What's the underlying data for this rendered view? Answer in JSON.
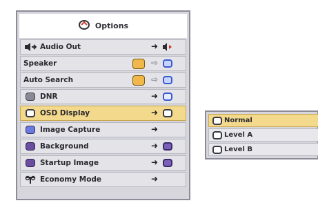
{
  "menu": {
    "title": "Options",
    "items": [
      {
        "label": "Audio Out",
        "lead_icon": "speaker-audio-out-icon",
        "setting_icon": "speaker-red-arrow-icon"
      },
      {
        "label": "Speaker",
        "toggle": true,
        "setting_icon": "blue-box-icon"
      },
      {
        "label": "Auto Search",
        "toggle": true,
        "setting_icon": "blue-box-icon"
      },
      {
        "label": "DNR",
        "lead_icon": "dnr-icon",
        "setting_icon": "dnr-level-icon"
      },
      {
        "label": "OSD Display",
        "lead_icon": "osd-display-icon",
        "setting_icon": "osd-display-icon",
        "selected": true
      },
      {
        "label": "Image Capture",
        "lead_icon": "image-capture-icon"
      },
      {
        "label": "Background",
        "lead_icon": "background-icon",
        "setting_icon": "purple-box-icon"
      },
      {
        "label": "Startup Image",
        "lead_icon": "startup-image-icon",
        "setting_icon": "purple-box-icon"
      },
      {
        "label": "Economy Mode",
        "lead_icon": "economy-mode-icon"
      }
    ]
  },
  "submenu": {
    "options": [
      {
        "label": "Normal",
        "selected": true
      },
      {
        "label": "Level A"
      },
      {
        "label": "Level B"
      }
    ]
  },
  "colors": {
    "highlight": "#f3d98c",
    "panel": "#d6d6dc",
    "toggle": "#f0b84a",
    "blue_icon": "#3a5ad0",
    "purple_icon": "#6a4fa0"
  }
}
